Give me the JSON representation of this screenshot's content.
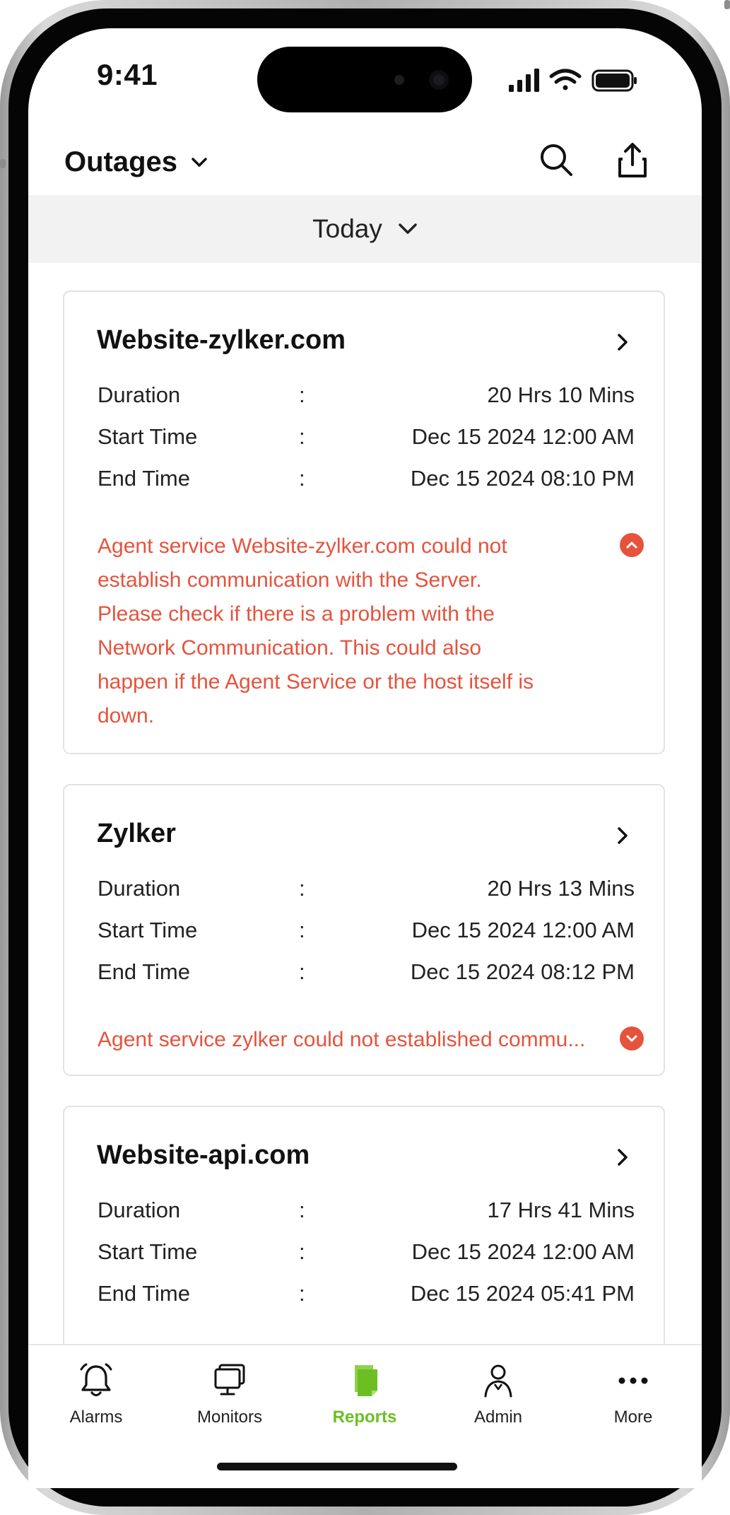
{
  "status_bar": {
    "time": "9:41"
  },
  "header": {
    "title": "Outages"
  },
  "date_filter": {
    "label": "Today"
  },
  "cards": [
    {
      "name": "Website-zylker.com",
      "rows": [
        {
          "label": "Duration",
          "sep": ":",
          "value": "20 Hrs 10 Mins"
        },
        {
          "label": "Start Time",
          "sep": ":",
          "value": "Dec 15 2024 12:00 AM"
        },
        {
          "label": "End Time",
          "sep": ":",
          "value": "Dec 15 2024 08:10 PM"
        }
      ],
      "error_lines": [
        "Agent service Website-zylker.com could not",
        "establish communication with the Server.",
        "Please check if there is a problem with the",
        "Network Communication. This could also",
        "happen if the Agent Service or the host itself is",
        "down."
      ],
      "expanded": true
    },
    {
      "name": "Zylker",
      "rows": [
        {
          "label": "Duration",
          "sep": ":",
          "value": "20 Hrs 13 Mins"
        },
        {
          "label": "Start Time",
          "sep": ":",
          "value": "Dec 15 2024 12:00 AM"
        },
        {
          "label": "End Time",
          "sep": ":",
          "value": "Dec 15 2024 08:12 PM"
        }
      ],
      "error_lines": [
        "Agent service zylker could not established commu..."
      ],
      "expanded": false
    },
    {
      "name": "Website-api.com",
      "rows": [
        {
          "label": "Duration",
          "sep": ":",
          "value": "17 Hrs 41 Mins"
        },
        {
          "label": "Start Time",
          "sep": ":",
          "value": "Dec 15 2024 12:00 AM"
        },
        {
          "label": "End Time",
          "sep": ":",
          "value": "Dec 15 2024 05:41 PM"
        }
      ]
    }
  ],
  "tabs": [
    {
      "label": "Alarms",
      "icon": "bell-icon"
    },
    {
      "label": "Monitors",
      "icon": "monitors-icon"
    },
    {
      "label": "Reports",
      "icon": "reports-icon",
      "active": true
    },
    {
      "label": "Admin",
      "icon": "admin-icon"
    },
    {
      "label": "More",
      "icon": "more-icon"
    }
  ],
  "colors": {
    "error": "#e5533d",
    "active_tab": "#6cbf22",
    "date_bar_bg": "#f2f2f2"
  }
}
